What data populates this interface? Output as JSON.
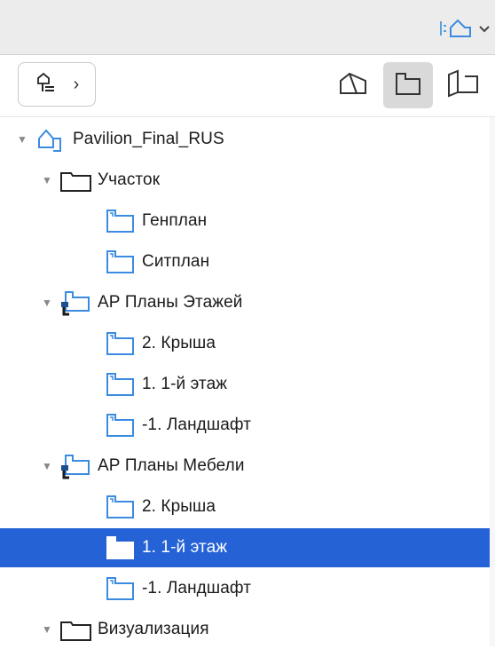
{
  "title_menu": {
    "icon": "project-map-icon",
    "caret_icon": "chevron-down-icon"
  },
  "toolbar": {
    "nav_icon": "tree-structure-icon",
    "nav_arrow": "›",
    "views": [
      {
        "icon": "3d-view-icon",
        "active": false
      },
      {
        "icon": "floor-plan-icon",
        "active": true
      },
      {
        "icon": "section-view-icon",
        "active": false
      }
    ]
  },
  "tree": [
    {
      "label": "Pavilion_Final_RUS",
      "level": 0,
      "icon": "project-icon",
      "expanded": true
    },
    {
      "label": "Участок",
      "level": 1,
      "icon": "folder-icon",
      "expanded": true
    },
    {
      "label": "Генплан",
      "level": 2,
      "icon": "plan-view-icon"
    },
    {
      "label": "Ситплан",
      "level": 2,
      "icon": "plan-view-icon"
    },
    {
      "label": "АР Планы Этажей",
      "level": 1,
      "icon": "plan-set-icon",
      "expanded": true
    },
    {
      "label": "2. Крыша",
      "level": 2,
      "icon": "plan-view-icon"
    },
    {
      "label": "1. 1-й этаж",
      "level": 2,
      "icon": "plan-view-icon"
    },
    {
      "label": "-1. Ландшафт",
      "level": 2,
      "icon": "plan-view-icon"
    },
    {
      "label": "АР Планы Мебели",
      "level": 1,
      "icon": "plan-set-icon",
      "expanded": true
    },
    {
      "label": "2. Крыша",
      "level": 2,
      "icon": "plan-view-icon"
    },
    {
      "label": "1. 1-й этаж",
      "level": 2,
      "icon": "plan-view-icon",
      "selected": true
    },
    {
      "label": "-1. Ландшафт",
      "level": 2,
      "icon": "plan-view-icon"
    },
    {
      "label": "Визуализация",
      "level": 1,
      "icon": "folder-icon",
      "expanded": true
    }
  ]
}
